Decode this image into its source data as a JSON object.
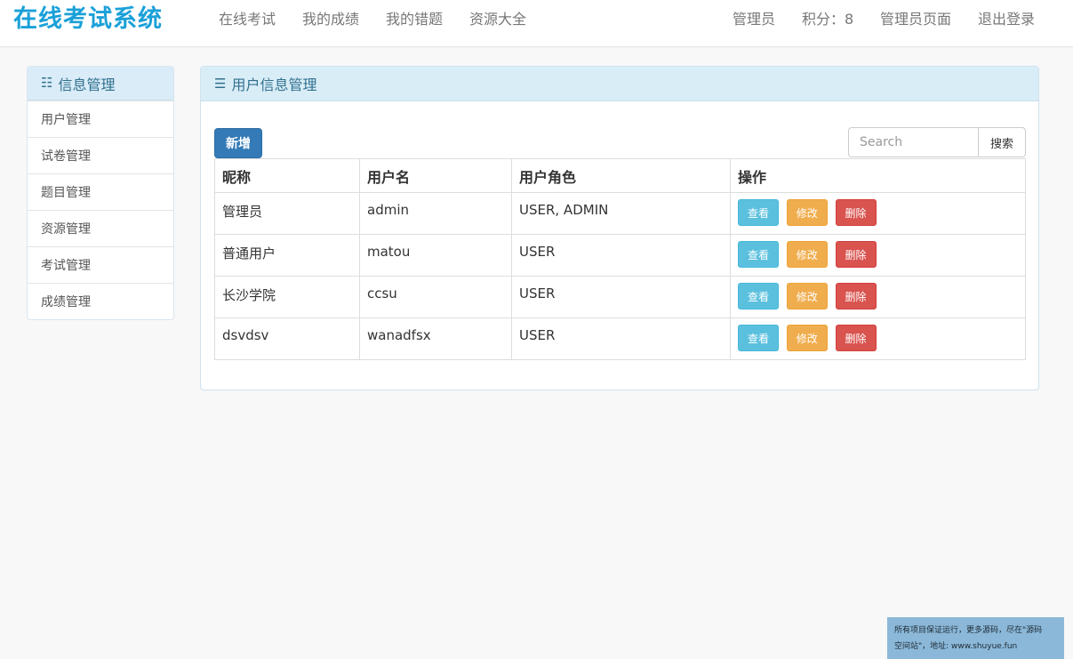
{
  "header": {
    "brand": "在线考试系统",
    "nav": [
      "在线考试",
      "我的成绩",
      "我的错题",
      "资源大全"
    ],
    "user_name": "管理员",
    "points": "积分：8",
    "admin_page": "管理员页面",
    "logout": "退出登录"
  },
  "sidebar": {
    "title": "信息管理",
    "items": [
      "用户管理",
      "试卷管理",
      "题目管理",
      "资源管理",
      "考试管理",
      "成绩管理"
    ]
  },
  "main": {
    "title": "用户信息管理",
    "add_label": "新增",
    "search_placeholder": "Search",
    "search_label": "搜索",
    "table": {
      "headers": [
        "昵称",
        "用户名",
        "用户角色",
        "操作"
      ],
      "rows": [
        {
          "nickname": "管理员",
          "username": "admin",
          "role": "USER, ADMIN"
        },
        {
          "nickname": "普通用户",
          "username": "matou",
          "role": "USER"
        },
        {
          "nickname": "长沙学院",
          "username": "ccsu",
          "role": "USER"
        },
        {
          "nickname": "dsvdsv",
          "username": "wanadfsx",
          "role": "USER"
        }
      ],
      "view_label": "查看",
      "edit_label": "修改",
      "delete_label": "删除"
    }
  },
  "watermark": {
    "line1": "所有项目保证运行，更多源码，尽在\"源码",
    "line2": "空间站\"，地址: www.shuyue.fun"
  },
  "colors": {
    "brand": "#1aa0d8",
    "primary": "#337ab7",
    "info": "#5bc0de",
    "warning": "#f0ad4e",
    "danger": "#d9534f",
    "panel_head": "#d9edf7"
  }
}
